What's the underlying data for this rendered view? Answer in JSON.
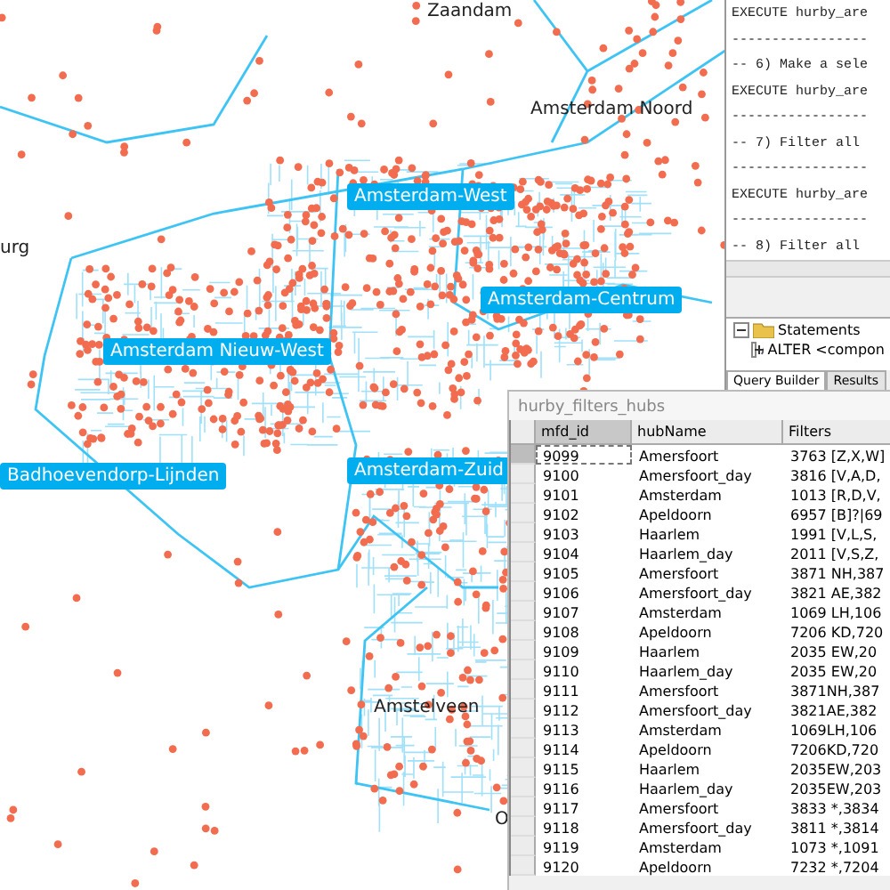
{
  "map": {
    "places": [
      {
        "name": "Zaandam",
        "kind": "town"
      },
      {
        "name": "Amsterdam Noord",
        "kind": "town"
      },
      {
        "name": "urg",
        "kind": "town"
      },
      {
        "name": "Amsterdam-West",
        "kind": "district"
      },
      {
        "name": "Amsterdam-Centrum",
        "kind": "district"
      },
      {
        "name": "Amsterdam Nieuw-West",
        "kind": "district"
      },
      {
        "name": "Badhoevendorp-Lijnden",
        "kind": "district"
      },
      {
        "name": "Amsterdam-Zuid",
        "kind": "district"
      },
      {
        "name": "Amstelveen",
        "kind": "town"
      },
      {
        "name": "O",
        "kind": "town"
      }
    ]
  },
  "editor": {
    "lines": [
      "EXECUTE hurby_are",
      "-----------------",
      "-- 6) Make a sele",
      "EXECUTE hurby_are",
      "-----------------",
      "-- 7) Filter all",
      "-----------------",
      "EXECUTE hurby_are",
      "-----------------",
      "-- 8) Filter all"
    ],
    "tree": [
      {
        "label": "Statements",
        "expanded": true,
        "children": [
          {
            "label": "ALTER <compon",
            "expanded": false
          }
        ]
      }
    ],
    "tabs": [
      {
        "label": "Query Builder",
        "selected": true
      },
      {
        "label": "Results",
        "selected": false
      }
    ]
  },
  "table": {
    "title": "hurby_filters_hubs",
    "columns": [
      {
        "label": "mfd_id",
        "selected": true
      },
      {
        "label": "hubName",
        "selected": false
      },
      {
        "label": "Filters",
        "selected": false
      }
    ],
    "rows": [
      {
        "cells": [
          "9099",
          "Amersfoort",
          "3763 [Z,X,W]"
        ],
        "selected": true
      },
      {
        "cells": [
          "9100",
          "Amersfoort_day",
          "3816 [V,A,D,"
        ],
        "selected": false
      },
      {
        "cells": [
          "9101",
          "Amsterdam",
          "1013 [R,D,V,"
        ],
        "selected": false
      },
      {
        "cells": [
          "9102",
          "Apeldoorn",
          "6957 [B]?|69"
        ],
        "selected": false
      },
      {
        "cells": [
          "9103",
          "Haarlem",
          "1991 [V,L,S,"
        ],
        "selected": false
      },
      {
        "cells": [
          "9104",
          "Haarlem_day",
          "2011 [V,S,Z,"
        ],
        "selected": false
      },
      {
        "cells": [
          "9105",
          "Amersfoort",
          "3871 NH,387"
        ],
        "selected": false
      },
      {
        "cells": [
          "9106",
          "Amersfoort_day",
          "3821 AE,382"
        ],
        "selected": false
      },
      {
        "cells": [
          "9107",
          "Amsterdam",
          "1069 LH,106"
        ],
        "selected": false
      },
      {
        "cells": [
          "9108",
          "Apeldoorn",
          "7206 KD,720"
        ],
        "selected": false
      },
      {
        "cells": [
          "9109",
          "Haarlem",
          "2035 EW,20"
        ],
        "selected": false
      },
      {
        "cells": [
          "9110",
          "Haarlem_day",
          "2035 EW,20"
        ],
        "selected": false
      },
      {
        "cells": [
          "9111",
          "Amersfoort",
          "3871NH,387"
        ],
        "selected": false
      },
      {
        "cells": [
          "9112",
          "Amersfoort_day",
          "3821AE,382"
        ],
        "selected": false
      },
      {
        "cells": [
          "9113",
          "Amsterdam",
          "1069LH,106"
        ],
        "selected": false
      },
      {
        "cells": [
          "9114",
          "Apeldoorn",
          "7206KD,720"
        ],
        "selected": false
      },
      {
        "cells": [
          "9115",
          "Haarlem",
          "2035EW,203"
        ],
        "selected": false
      },
      {
        "cells": [
          "9116",
          "Haarlem_day",
          "2035EW,203"
        ],
        "selected": false
      },
      {
        "cells": [
          "9117",
          "Amersfoort",
          "3833 *,3834"
        ],
        "selected": false
      },
      {
        "cells": [
          "9118",
          "Amersfoort_day",
          "3811 *,3814"
        ],
        "selected": false
      },
      {
        "cells": [
          "9119",
          "Amsterdam",
          "1073 *,1091"
        ],
        "selected": false
      },
      {
        "cells": [
          "9120",
          "Apeldoorn",
          "7232 *,7204"
        ],
        "selected": false
      }
    ]
  }
}
